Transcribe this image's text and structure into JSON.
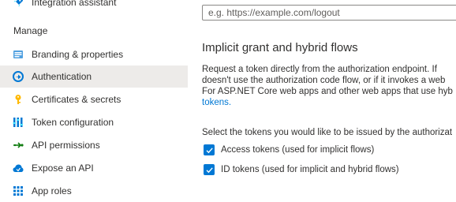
{
  "sidebar": {
    "top_item": {
      "label": "Integration assistant",
      "icon": "rocket-icon"
    },
    "section_label": "Manage",
    "items": [
      {
        "label": "Branding & properties",
        "icon": "branding-icon",
        "selected": false
      },
      {
        "label": "Authentication",
        "icon": "authentication-icon",
        "selected": true
      },
      {
        "label": "Certificates & secrets",
        "icon": "key-icon",
        "selected": false
      },
      {
        "label": "Token configuration",
        "icon": "token-config-icon",
        "selected": false
      },
      {
        "label": "API permissions",
        "icon": "api-permissions-icon",
        "selected": false
      },
      {
        "label": "Expose an API",
        "icon": "cloud-icon",
        "selected": false
      },
      {
        "label": "App roles",
        "icon": "grid-icon",
        "selected": false
      }
    ],
    "selected_color": "#edebe9"
  },
  "main": {
    "logout_url": {
      "placeholder": "e.g. https://example.com/logout",
      "value": ""
    },
    "implicit_section": {
      "title": "Implicit grant and hybrid flows",
      "description_lines": [
        "Request a token directly from the authorization endpoint. If",
        "doesn't use the authorization code flow, or if it invokes a web",
        "For ASP.NET Core web apps and other web apps that use hyb"
      ],
      "link_text": "tokens.",
      "select_text": "Select the tokens you would like to be issued by the authorizat",
      "checkboxes": [
        {
          "label": "Access tokens (used for implicit flows)",
          "checked": true
        },
        {
          "label": "ID tokens (used for implicit and hybrid flows)",
          "checked": true
        }
      ]
    }
  },
  "colors": {
    "accent": "#0078d4",
    "text": "#323130",
    "input_border": "#8a8886"
  }
}
